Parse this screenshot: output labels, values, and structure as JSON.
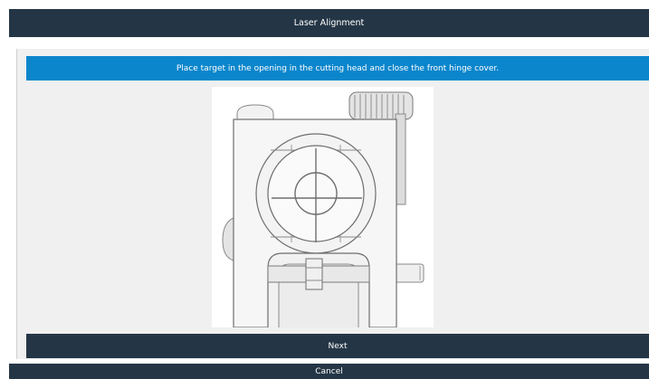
{
  "window": {
    "title": "Laser Alignment"
  },
  "instruction": {
    "text": "Place target in the opening in the cutting head and close the front hinge cover."
  },
  "illustration": {
    "name": "cutting-head-target-illustration"
  },
  "actions": {
    "next_label": "Next",
    "cancel_label": "Cancel"
  },
  "colors": {
    "header": "#243646",
    "banner": "#0b86cc",
    "panel": "#f0f0f0",
    "text_light": "#ffffff"
  }
}
